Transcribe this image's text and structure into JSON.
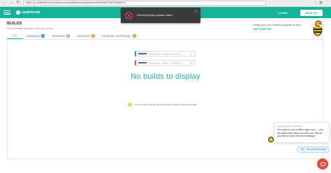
{
  "browser": {
    "url": "https://g.codefresh.io/public/accounts/rafrahim/ws/pipelines/5e8b48637b4d7f9ba917e",
    "back_icon": "arrow-left-icon",
    "forward_icon": "arrow-right-icon",
    "reload_icon": "reload-icon"
  },
  "header": {
    "logo_text": "codefresh",
    "login_label": "LOGIN",
    "signup_label": "SIGN UP",
    "brand_color": "#15b39a"
  },
  "page": {
    "title": "BUILDS",
    "subtitle": "View all builds associated with this pipeline"
  },
  "promo": {
    "text": "Create your own Codefresh pipeline for free!",
    "cta": "GET STARTED"
  },
  "tabs": [
    {
      "label": "ALL",
      "count": null,
      "color": "#15b39a",
      "active": true
    },
    {
      "label": "RUNNING",
      "count": "0",
      "color": "#4a90e2",
      "active": false
    },
    {
      "label": "PENDING",
      "count": "0",
      "color": "#b3b3b3",
      "active": false
    },
    {
      "label": "DELAYED",
      "count": "0",
      "color": "#f0a030",
      "active": false
    },
    {
      "label": "PENDING APPROVAL",
      "count": "0",
      "color": "#f0a030",
      "active": false
    }
  ],
  "empty_state": {
    "message": "No builds to display",
    "hint": "You can filter through all your builds to search status and tags"
  },
  "toast": {
    "message": "Fetching Builds updates failed..."
  },
  "chat": {
    "sender": "Superhero from Codefresh",
    "message": "Our team is out of office right now 🌙 can we have them follow up with you. Would you like to leave them a message?",
    "reply_yes": "Yes",
    "reply_no": "No, just browsing"
  }
}
